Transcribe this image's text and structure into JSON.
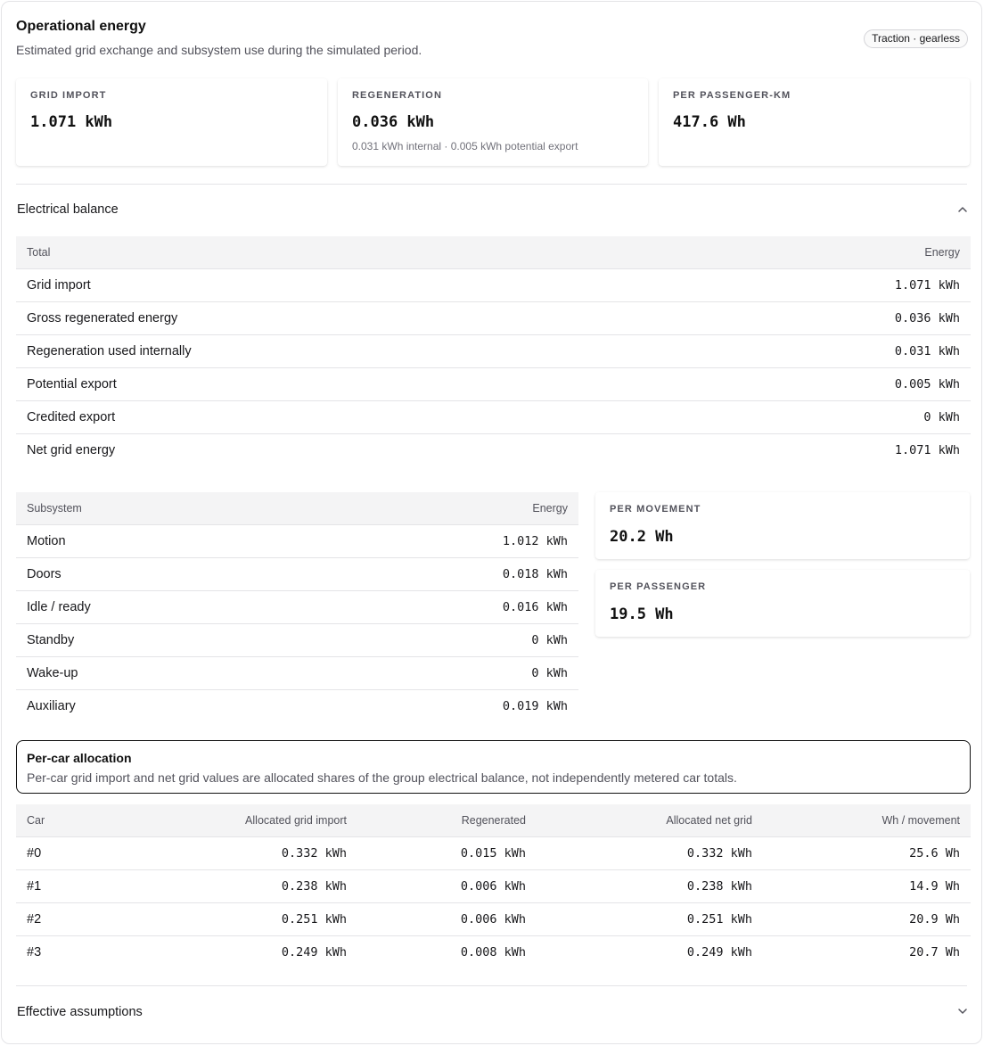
{
  "header": {
    "title": "Operational energy",
    "subtitle": "Estimated grid exchange and subsystem use during the simulated period.",
    "badge": "Traction · gearless"
  },
  "metrics": [
    {
      "label": "GRID IMPORT",
      "value": "1.071 kWh",
      "note": ""
    },
    {
      "label": "REGENERATION",
      "value": "0.036 kWh",
      "note": "0.031 kWh internal · 0.005 kWh potential export"
    },
    {
      "label": "PER PASSENGER-KM",
      "value": "417.6 Wh",
      "note": ""
    }
  ],
  "electrical_balance": {
    "title": "Electrical balance",
    "columns": [
      "Total",
      "Energy"
    ],
    "rows": [
      {
        "label": "Grid import",
        "value": "1.071 kWh"
      },
      {
        "label": "Gross regenerated energy",
        "value": "0.036 kWh"
      },
      {
        "label": "Regeneration used internally",
        "value": "0.031 kWh"
      },
      {
        "label": "Potential export",
        "value": "0.005 kWh"
      },
      {
        "label": "Credited export",
        "value": "0 kWh"
      },
      {
        "label": "Net grid energy",
        "value": "1.071 kWh"
      }
    ]
  },
  "subsystems": {
    "columns": [
      "Subsystem",
      "Energy"
    ],
    "rows": [
      {
        "label": "Motion",
        "value": "1.012 kWh"
      },
      {
        "label": "Doors",
        "value": "0.018 kWh"
      },
      {
        "label": "Idle / ready",
        "value": "0.016 kWh"
      },
      {
        "label": "Standby",
        "value": "0 kWh"
      },
      {
        "label": "Wake-up",
        "value": "0 kWh"
      },
      {
        "label": "Auxiliary",
        "value": "0.019 kWh"
      }
    ]
  },
  "side_metrics": [
    {
      "label": "PER MOVEMENT",
      "value": "20.2 Wh"
    },
    {
      "label": "PER PASSENGER",
      "value": "19.5 Wh"
    }
  ],
  "allocation": {
    "title": "Per-car allocation",
    "text": "Per-car grid import and net grid values are allocated shares of the group electrical balance, not independently metered car totals.",
    "columns": [
      "Car",
      "Allocated grid import",
      "Regenerated",
      "Allocated net grid",
      "Wh / movement"
    ],
    "rows": [
      [
        "#0",
        "0.332 kWh",
        "0.015 kWh",
        "0.332 kWh",
        "25.6 Wh"
      ],
      [
        "#1",
        "0.238 kWh",
        "0.006 kWh",
        "0.238 kWh",
        "14.9 Wh"
      ],
      [
        "#2",
        "0.251 kWh",
        "0.006 kWh",
        "0.251 kWh",
        "20.9 Wh"
      ],
      [
        "#3",
        "0.249 kWh",
        "0.008 kWh",
        "0.249 kWh",
        "20.7 Wh"
      ]
    ]
  },
  "assumptions": {
    "title": "Effective assumptions"
  }
}
